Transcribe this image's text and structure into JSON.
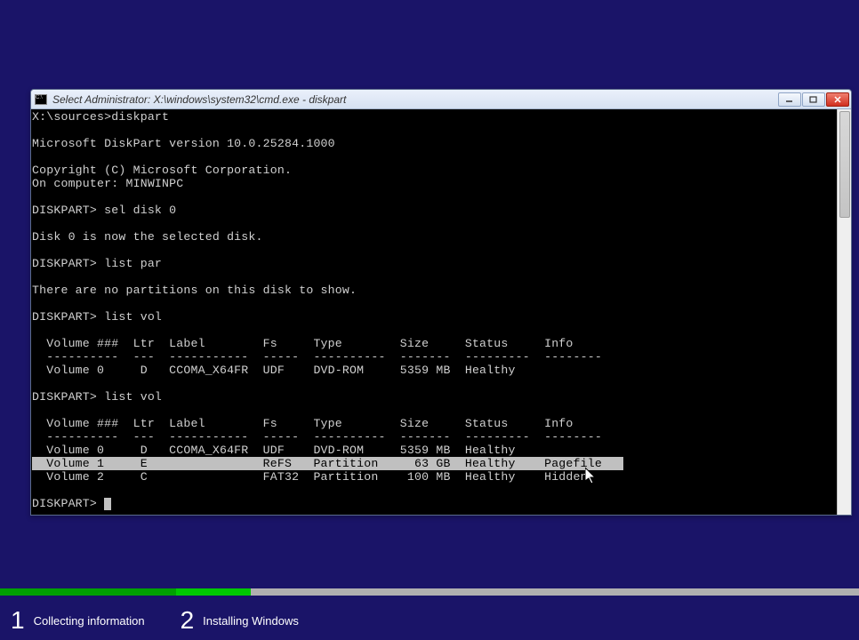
{
  "window": {
    "title": "Select Administrator: X:\\windows\\system32\\cmd.exe - diskpart"
  },
  "console": {
    "prompt_line": "X:\\sources>diskpart",
    "blank1": "",
    "version_line": "Microsoft DiskPart version 10.0.25284.1000",
    "blank2": "",
    "copyright_line": "Copyright (C) Microsoft Corporation.",
    "computer_line": "On computer: MINWINPC",
    "blank3": "",
    "cmd1": "DISKPART> sel disk 0",
    "blank4": "",
    "resp1": "Disk 0 is now the selected disk.",
    "blank5": "",
    "cmd2": "DISKPART> list par",
    "blank6": "",
    "resp2": "There are no partitions on this disk to show.",
    "blank7": "",
    "cmd3": "DISKPART> list vol",
    "blank8": "",
    "vol_header1": "  Volume ###  Ltr  Label        Fs     Type        Size     Status     Info",
    "vol_divider1": "  ----------  ---  -----------  -----  ----------  -------  ---------  --------",
    "vol1_row0": "  Volume 0     D   CCOMA_X64FR  UDF    DVD-ROM     5359 MB  Healthy",
    "blank9": "",
    "cmd4": "DISKPART> list vol",
    "blank10": "",
    "vol_header2": "  Volume ###  Ltr  Label        Fs     Type        Size     Status     Info",
    "vol_divider2": "  ----------  ---  -----------  -----  ----------  -------  ---------  --------",
    "vol2_row0": "  Volume 0     D   CCOMA_X64FR  UDF    DVD-ROM     5359 MB  Healthy",
    "vol2_row1": "  Volume 1     E                ReFS   Partition     63 GB  Healthy    Pagefile   ",
    "vol2_row2": "  Volume 2     C                FAT32  Partition    100 MB  Healthy    Hidden",
    "blank11": "",
    "final_prompt": "DISKPART> "
  },
  "progress": {
    "step1_num": "1",
    "step1_label": "Collecting information",
    "step2_num": "2",
    "step2_label": "Installing Windows"
  }
}
